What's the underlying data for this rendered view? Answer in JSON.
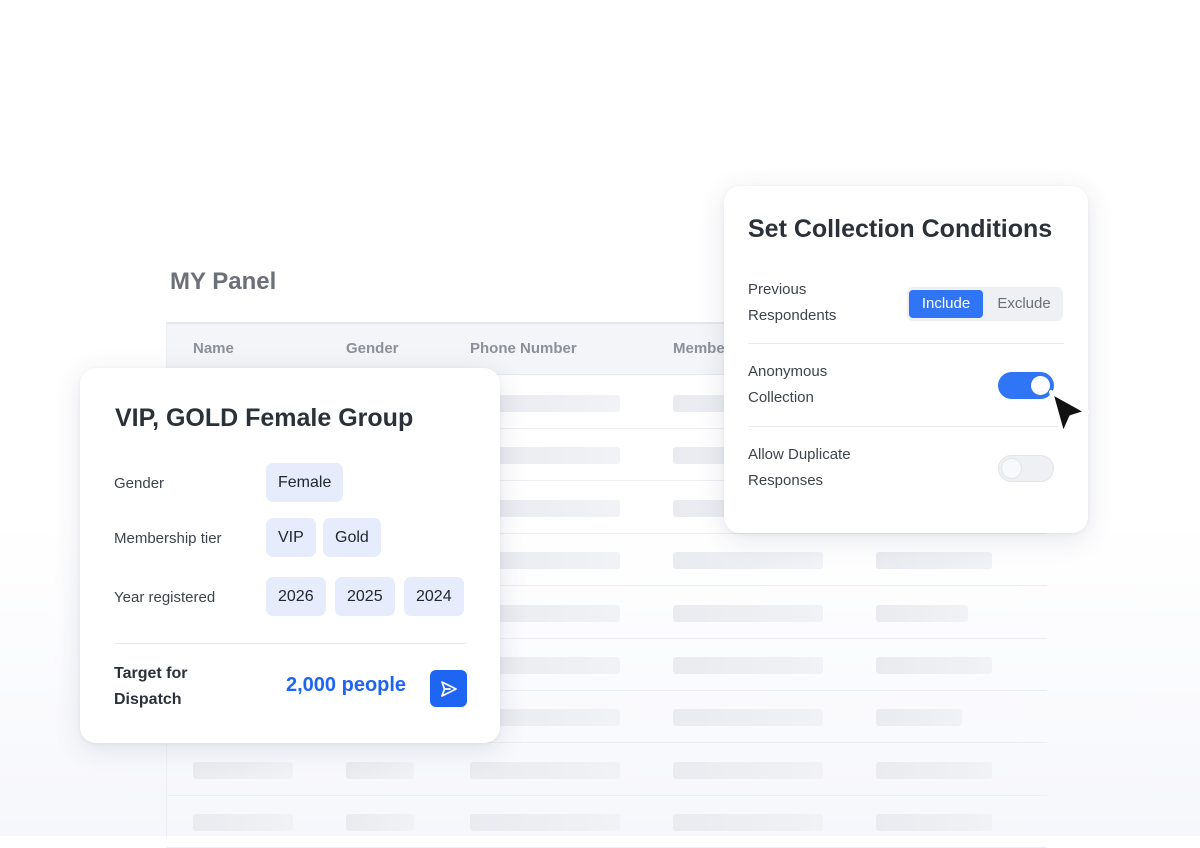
{
  "panel": {
    "title": "MY Panel",
    "columns": [
      "Name",
      "Gender",
      "Phone Number",
      "Membe"
    ]
  },
  "group": {
    "title": "VIP, GOLD Female Group",
    "gender_label": "Gender",
    "gender_values": [
      "Female"
    ],
    "membership_label": "Membership tier",
    "membership_values": [
      "VIP",
      "Gold"
    ],
    "year_label": "Year registered",
    "year_values": [
      "2026",
      "2025",
      "2024"
    ],
    "target_label": "Target for Dispatch",
    "target_value": "2,000 people",
    "send_icon": "send-icon"
  },
  "conditions": {
    "title": "Set Collection Conditions",
    "previous_label": "Previous Respondents",
    "include_label": "Include",
    "exclude_label": "Exclude",
    "previous_selected": "Include",
    "anonymous_label": "Anonymous Collection",
    "anonymous_on": true,
    "duplicate_label": "Allow Duplicate Responses",
    "duplicate_on": false
  },
  "colors": {
    "accent": "#2f75f5",
    "target_blue": "#1d65f2",
    "chip_bg": "#e6ecfb"
  }
}
